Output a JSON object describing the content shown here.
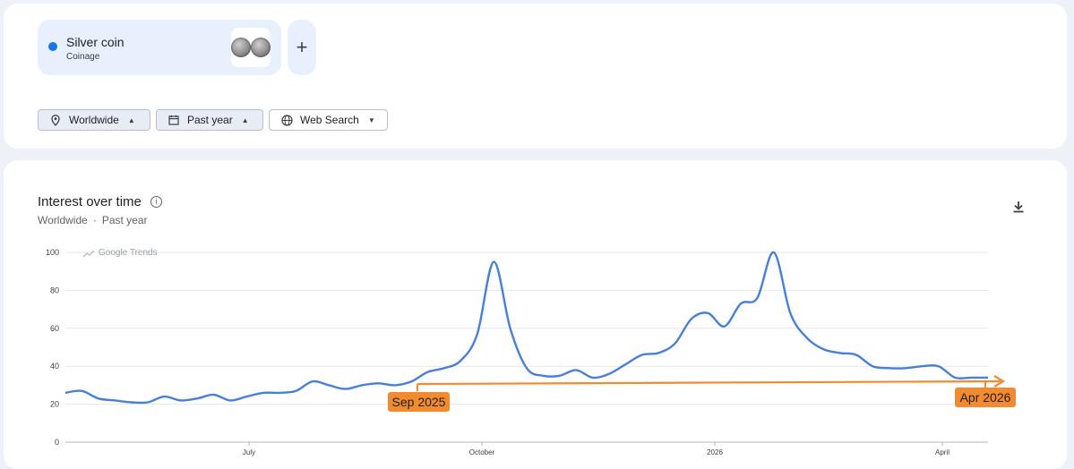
{
  "search_term": {
    "name": "Silver coin",
    "category": "Coinage",
    "color": "#1a73e8"
  },
  "add_button": {
    "label": "+"
  },
  "filters": {
    "region": "Worldwide",
    "time": "Past year",
    "property": "Web Search"
  },
  "card": {
    "title": "Interest over time",
    "info_icon": "info-icon",
    "subtitle_region": "Worldwide",
    "subtitle_sep": "·",
    "subtitle_time": "Past year",
    "download_icon": "download-icon"
  },
  "watermark": "Google Trends",
  "annotations": {
    "start_label": "Sep 2025",
    "end_label": "Apr 2026",
    "arrow_color": "#f28a30"
  },
  "chart_data": {
    "type": "line",
    "y_ticks": [
      0,
      20,
      40,
      60,
      80,
      100
    ],
    "ylim": [
      0,
      100
    ],
    "x_tick_labels": [
      "July",
      "October",
      "2026",
      "April"
    ],
    "grid": true,
    "series": [
      {
        "color": "#4a7fd6",
        "values": [
          26,
          27,
          23,
          22,
          21,
          21,
          24,
          22,
          23,
          25,
          22,
          24,
          26,
          26,
          27,
          32,
          30,
          28,
          30,
          31,
          30,
          32,
          37,
          39,
          43,
          57,
          95,
          60,
          39,
          35,
          35,
          38,
          34,
          36,
          41,
          46,
          47,
          52,
          65,
          68,
          61,
          73,
          76,
          100,
          68,
          55,
          49,
          47,
          46,
          40,
          39,
          39,
          40,
          40,
          34,
          34,
          34
        ]
      }
    ]
  }
}
